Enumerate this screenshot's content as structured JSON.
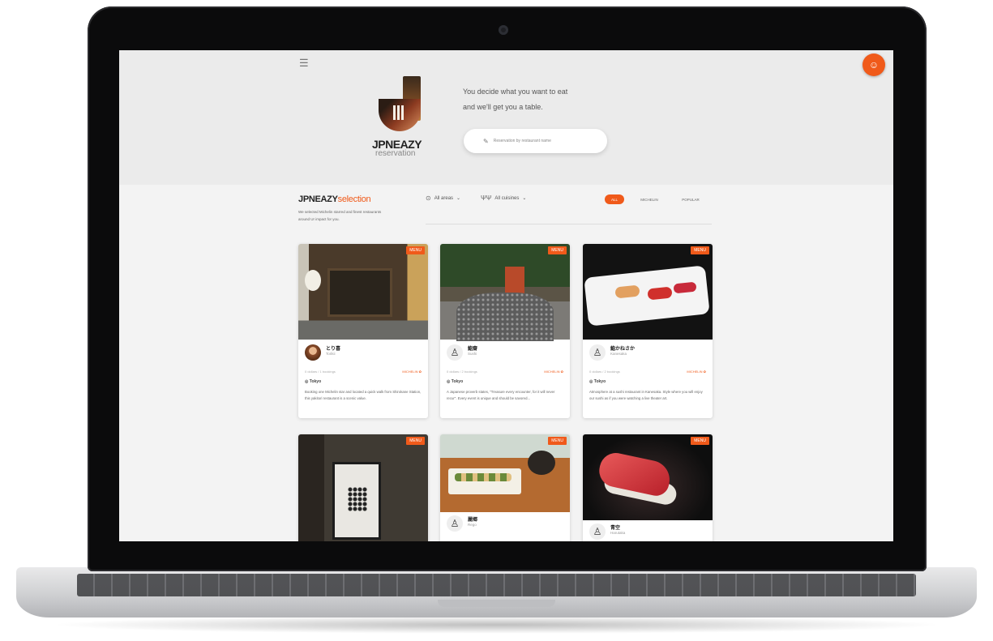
{
  "header": {
    "brand_name": "JPNEAZY",
    "brand_sub": "reservation",
    "tagline_line1": "You decide what you want to eat",
    "tagline_line2": "and we'll get you a table.",
    "search_placeholder": "Reservation by restaurant name",
    "menu_icon": "hamburger-icon",
    "user_icon": "user-icon"
  },
  "selection": {
    "title_main": "JPNEAZY",
    "title_accent": "selection",
    "description": "We selected Michelin starred and finest restaurants around Ur impact for you.",
    "filter_area": "All areas",
    "filter_cuisine": "All cuisines",
    "tabs": [
      "ALL",
      "MICHELIN",
      "POPULAR"
    ],
    "active_tab": "ALL"
  },
  "accent_color": "#f05a1a",
  "cards": [
    {
      "badge": "MENU",
      "name": "とり喜",
      "sub": "Torikii",
      "meta": "0 dollars / 1 bookings",
      "michelin": "MICHELIN ✿",
      "location": "Tokyo",
      "description": "Booking one Michelin star and located a quick walk from Shirokane Station, this yakitori restaurant is a scenic value."
    },
    {
      "badge": "MENU",
      "name": "鮨齋",
      "sub": "Sushi",
      "meta": "0 dollars / 2 bookings",
      "michelin": "MICHELIN ✿",
      "location": "Tokyo",
      "description": "A Japanese proverb states, \"Treasure every encounter, for it will never recur\". Every event is unique and should be savored..."
    },
    {
      "badge": "MENU",
      "name": "鮨かねさか",
      "sub": "Kanesaka",
      "meta": "0 dollars / 2 bookings",
      "michelin": "MICHELIN ✿",
      "location": "Tokyo",
      "description": "Atmosphere at a sushi restaurant in Kanesaka. Style where you will enjoy our sushi as if you were watching a live theater art."
    },
    {
      "badge": "MENU",
      "name": "",
      "sub": "",
      "meta": "",
      "michelin": "",
      "location": "",
      "description": ""
    },
    {
      "badge": "MENU",
      "name": "麗郷",
      "sub": "Rego",
      "meta": "",
      "michelin": "",
      "location": "",
      "description": ""
    },
    {
      "badge": "MENU",
      "name": "青空",
      "sub": "Harutaka",
      "meta": "",
      "michelin": "",
      "location": "",
      "description": ""
    }
  ]
}
